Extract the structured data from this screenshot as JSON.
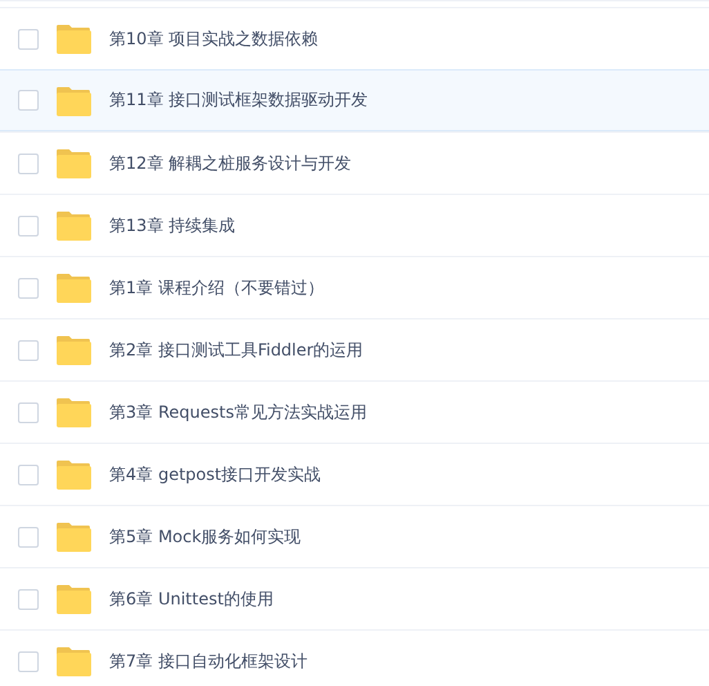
{
  "folders": [
    {
      "name": "第10章 项目实战之数据依赖",
      "checked": false,
      "highlighted": false
    },
    {
      "name": "第11章 接口测试框架数据驱动开发",
      "checked": false,
      "highlighted": true
    },
    {
      "name": "第12章 解耦之桩服务设计与开发",
      "checked": false,
      "highlighted": false
    },
    {
      "name": "第13章 持续集成",
      "checked": false,
      "highlighted": false
    },
    {
      "name": "第1章 课程介绍（不要错过）",
      "checked": false,
      "highlighted": false
    },
    {
      "name": "第2章 接口测试工具Fiddler的运用",
      "checked": false,
      "highlighted": false
    },
    {
      "name": "第3章 Requests常见方法实战运用",
      "checked": false,
      "highlighted": false
    },
    {
      "name": "第4章 getpost接口开发实战",
      "checked": false,
      "highlighted": false
    },
    {
      "name": "第5章 Mock服务如何实现",
      "checked": false,
      "highlighted": false
    },
    {
      "name": "第6章 Unittest的使用",
      "checked": false,
      "highlighted": false
    },
    {
      "name": "第7章 接口自动化框架设计",
      "checked": false,
      "highlighted": false
    }
  ]
}
